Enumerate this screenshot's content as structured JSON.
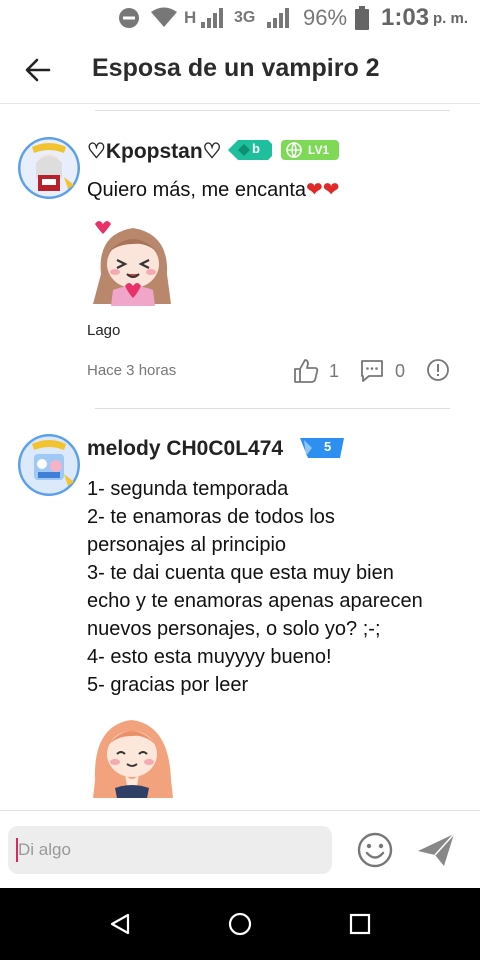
{
  "status_bar": {
    "network_h": "H",
    "network_3g": "3G",
    "battery_percent": "96%",
    "time": "1:03",
    "ampm": "p. m.",
    "icons": [
      "do-not-disturb-icon",
      "wifi-icon",
      "signal-icon",
      "signal-icon",
      "battery-icon"
    ]
  },
  "header": {
    "title": "Esposa de un vampiro 2",
    "back_icon": "arrow-left-icon"
  },
  "comments": [
    {
      "username": "♡Kpopstan♡",
      "badge_reputation": "b",
      "badge_level": "LV1",
      "text": "Quiero más, me encanta",
      "text_emoji": "❤❤",
      "sticker_label": "Lago",
      "time": "Hace 3 horas",
      "likes": "1",
      "replies": "0"
    },
    {
      "username": "melody CH0C0L474",
      "badge_reputation": "5",
      "lines": [
        "1- segunda temporada",
        "2- te enamoras de todos los",
        "personajes al principio",
        "3- te dai cuenta que esta muy bien",
        "echo y te enamoras apenas aparecen",
        "nuevos personajes, o solo yo? ;-;",
        "4- esto esta muyyyy bueno!",
        "5- gracias por leer"
      ]
    }
  ],
  "composer": {
    "placeholder": "Di algo"
  },
  "colors": {
    "accent_green": "#1fbf6e",
    "badge_blue": "#2d8ff0",
    "heart_red": "#e02a2a",
    "caret_pink": "#e0245e"
  }
}
